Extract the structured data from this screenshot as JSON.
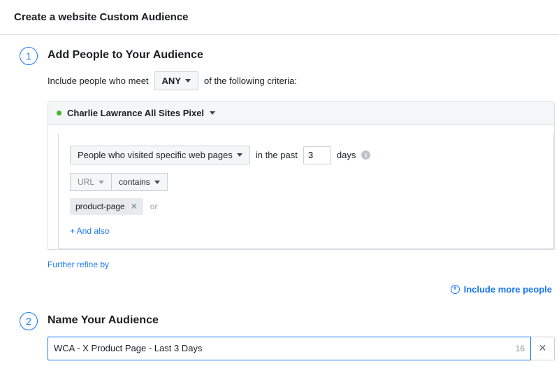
{
  "header": {
    "title": "Create a website Custom Audience"
  },
  "step1": {
    "number": "1",
    "title": "Add People to Your Audience",
    "include_prefix": "Include people who meet",
    "mode": "ANY",
    "include_suffix": "of the following criteria:",
    "pixel_name": "Charlie Lawrance All Sites Pixel",
    "visitor_type": "People who visited specific web pages",
    "in_the_past": "in the past",
    "days_value": "3",
    "days_label": "days",
    "url_label": "URL",
    "contains_label": "contains",
    "tag": "product-page",
    "or_label": "or",
    "and_also": "+ And also",
    "refine": "Further refine by",
    "include_more": "Include more people"
  },
  "step2": {
    "number": "2",
    "title": "Name Your Audience",
    "name_value": "WCA - X Product Page - Last 3 Days",
    "char_count": "16"
  }
}
